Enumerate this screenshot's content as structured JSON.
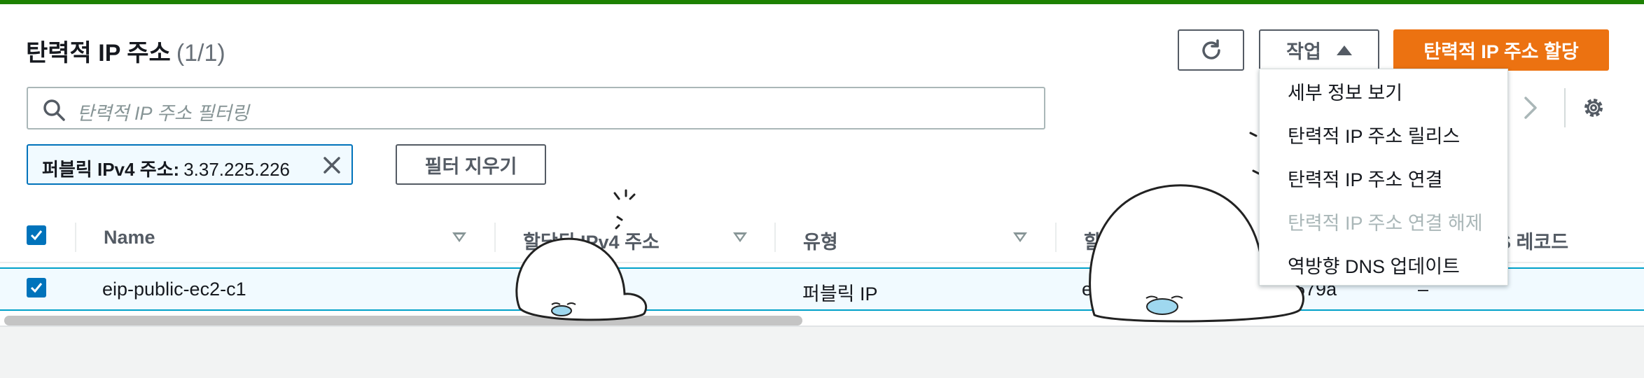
{
  "header": {
    "title": "탄력적 IP 주소",
    "count": "(1/1)",
    "actions_label": "작업",
    "allocate_label": "탄력적 IP 주소 할당"
  },
  "search": {
    "placeholder": "탄력적 IP 주소 필터링"
  },
  "filter_token": {
    "label": "퍼블릭 IPv4 주소:",
    "value": "3.37.225.226"
  },
  "clear_filters_label": "필터 지우기",
  "table": {
    "columns": [
      "Name",
      "할당된 IPv4 주소",
      "유형",
      "할",
      "S 레코드"
    ],
    "rows": [
      {
        "name": "eip-public-ec2-c1",
        "ipv4_partial": "",
        "type": "퍼블릭 IP",
        "alloc_partial": "e",
        "id_partial": "9679a",
        "dns_partial": "–"
      }
    ]
  },
  "actions_menu": {
    "items": [
      {
        "label": "세부 정보 보기",
        "enabled": true
      },
      {
        "label": "탄력적 IP 주소 릴리스",
        "enabled": true
      },
      {
        "label": "탄력적 IP 주소 연결",
        "enabled": true
      },
      {
        "label": "탄력적 IP 주소 연결 해제",
        "enabled": false
      },
      {
        "label": "역방향 DNS 업데이트",
        "enabled": true
      }
    ]
  },
  "colors": {
    "primary": "#ec7211",
    "selection": "#0073bb",
    "top_bar": "#1d8102"
  },
  "icons": [
    "refresh-icon",
    "caret-up-icon",
    "search-icon",
    "close-icon",
    "chevron-right-icon",
    "settings-icon",
    "checkbox-checked-icon",
    "sort-icon"
  ]
}
